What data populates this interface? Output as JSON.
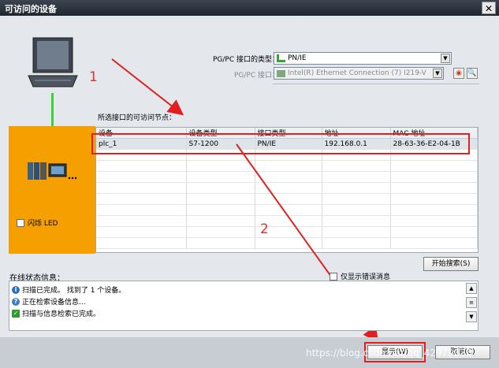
{
  "window": {
    "title": "可访问的设备",
    "close_glyph": "✕"
  },
  "interface": {
    "type_label": "PG/PC 接口的类型：",
    "type_value": "PN/IE",
    "iface_label": "PG/PC 接口：",
    "iface_value": "Intel(R) Ethernet Connection (7) I219-V"
  },
  "nodes": {
    "label": "所选接口的可访问节点：",
    "columns": [
      "设备",
      "设备类型",
      "接口类型",
      "地址",
      "MAC 地址"
    ],
    "rows": [
      [
        "plc_1",
        "S7-1200",
        "PN/IE",
        "192.168.0.1",
        "28-63-36-E2-04-1B"
      ]
    ]
  },
  "led_label": "闪烁 LED",
  "buttons": {
    "start_search": "开始搜索(S)",
    "show": "显示(W)",
    "cancel": "取消(C)"
  },
  "show_errors_label": "仅显示错误消息",
  "status": {
    "title": "在线状态信息：",
    "lines": [
      {
        "icon": "info-icon",
        "text": "扫描已完成。 找到了 1 个设备。"
      },
      {
        "icon": "question-icon",
        "text": "正在检索设备信息..."
      },
      {
        "icon": "check-icon",
        "text": "扫描与信息检索已完成。"
      }
    ]
  },
  "annotations": {
    "marker_1": "1",
    "marker_2": "2"
  },
  "watermark": "https://blog.csdn.net/qq_42979036",
  "colors": {
    "accent_orange": "#f5a000",
    "link_green": "#3cd13c",
    "annotation_red": "#e02020"
  }
}
